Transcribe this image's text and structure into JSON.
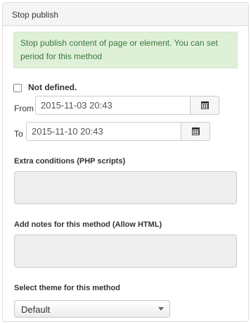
{
  "panel": {
    "title": "Stop publish"
  },
  "alert": {
    "text": "Stop publish content of page or element. You can set period for this method"
  },
  "not_defined": {
    "label": "Not defined.",
    "checked": false
  },
  "from": {
    "label": "From",
    "value": "2015-11-03 20:43",
    "button_icon": "calendar-icon"
  },
  "to": {
    "label": "To",
    "value": "2015-11-10 20:43",
    "button_icon": "calendar-icon"
  },
  "extra_conditions": {
    "label": "Extra conditions (PHP scripts)",
    "value": ""
  },
  "notes": {
    "label": "Add notes for this method (Allow HTML)",
    "value": ""
  },
  "theme": {
    "label": "Select theme for this method",
    "selected": "Default"
  },
  "colors": {
    "alert_bg": "#dff0d8",
    "alert_text": "#3c763d",
    "textarea_bg": "#eeeeee"
  }
}
